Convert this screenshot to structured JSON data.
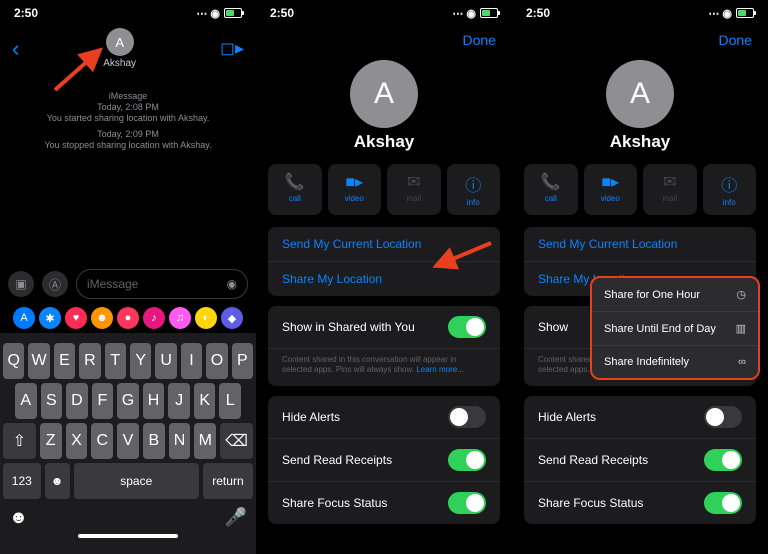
{
  "status": {
    "time": "2:50"
  },
  "panel1": {
    "contact": "Akshay",
    "avatar_initial": "A",
    "chat": {
      "label1": "iMessage",
      "line1a": "Today, 2:08 PM",
      "line1b": "You started sharing location with Akshay.",
      "line2a": "Today, 2:09 PM",
      "line2b": "You stopped sharing location with Akshay."
    },
    "input_placeholder": "iMessage",
    "keys": {
      "r1": [
        "Q",
        "W",
        "E",
        "R",
        "T",
        "Y",
        "U",
        "I",
        "O",
        "P"
      ],
      "r2": [
        "A",
        "S",
        "D",
        "F",
        "G",
        "H",
        "J",
        "K",
        "L"
      ],
      "r3": [
        "Z",
        "X",
        "C",
        "V",
        "B",
        "N",
        "M"
      ],
      "fn": {
        "num": "123",
        "space": "space",
        "ret": "return"
      }
    }
  },
  "detail": {
    "done": "Done",
    "name": "Akshay",
    "avatar_initial": "A",
    "buttons": {
      "call": "call",
      "video": "video",
      "mail": "mail",
      "info": "info"
    },
    "links": {
      "send_loc": "Send My Current Location",
      "share_loc": "Share My Location"
    },
    "shared_label": "Show in Shared with You",
    "shared_short": "Show",
    "shared_note": "Content shared in this conversation will appear in selected apps. Pins will always show. ",
    "learn_more": "Learn more...",
    "hide_alerts": "Hide Alerts",
    "read_receipts": "Send Read Receipts",
    "focus": "Share Focus Status"
  },
  "popup": {
    "hour": "Share for One Hour",
    "day": "Share Until End of Day",
    "indef": "Share Indefinitely"
  },
  "app_icons": [
    {
      "color": "#007aff",
      "sym": "A"
    },
    {
      "color": "#0a84ff",
      "sym": "✱"
    },
    {
      "color": "#ff2d55",
      "sym": "♥"
    },
    {
      "color": "#ff9500",
      "sym": "☻"
    },
    {
      "color": "#ff375f",
      "sym": "●"
    },
    {
      "color": "#e6177f",
      "sym": "♪"
    },
    {
      "color": "#ff5af2",
      "sym": "♫"
    },
    {
      "color": "#ffd60a",
      "sym": "◐"
    },
    {
      "color": "#5e5ce6",
      "sym": "◆"
    }
  ]
}
